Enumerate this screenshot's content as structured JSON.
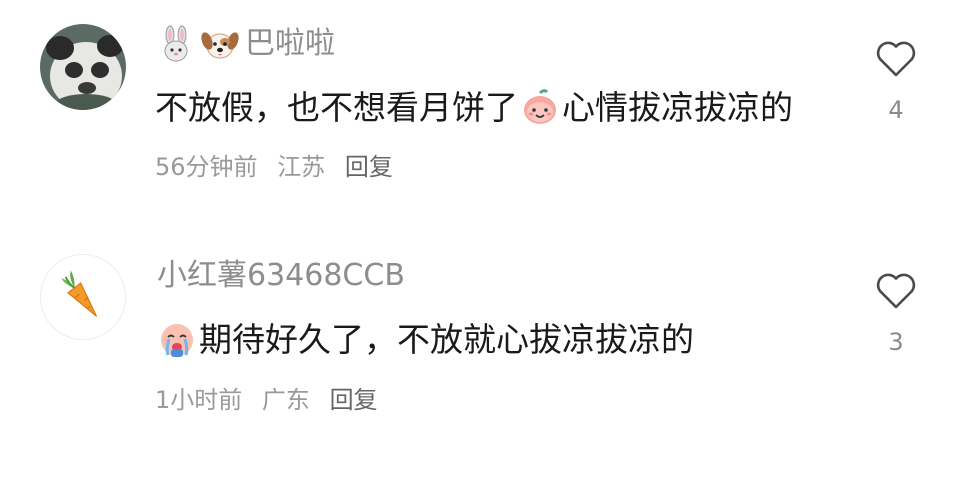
{
  "comments": [
    {
      "username": "巴啦啦",
      "username_icons": [
        "rabbit-emoji-icon",
        "dog-emoji-icon"
      ],
      "text_before": "不放假，也不想看月饼了",
      "text_emoji": "peach-face-emoji-icon",
      "text_after": "心情拔凉拔凉的",
      "time": "56分钟前",
      "location": "江苏",
      "reply_label": "回复",
      "like_count": "4"
    },
    {
      "username": "小红薯63468CCB",
      "text_emoji": "crying-face-emoji-icon",
      "text_after": "期待好久了，不放就心拔凉拔凉的",
      "time": "1小时前",
      "location": "广东",
      "reply_label": "回复",
      "like_count": "3"
    }
  ]
}
